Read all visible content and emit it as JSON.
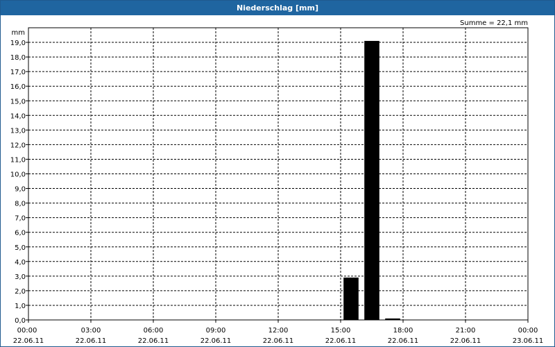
{
  "window": {
    "title": "Niederschlag [mm]"
  },
  "chart_data": {
    "type": "bar",
    "ylabel": "mm",
    "annotation": "Summe = 22,1 mm",
    "ylim": [
      0,
      20
    ],
    "yticks": [
      "0,0",
      "1,0",
      "2,0",
      "3,0",
      "4,0",
      "5,0",
      "6,0",
      "7,0",
      "8,0",
      "9,0",
      "10,0",
      "11,0",
      "12,0",
      "13,0",
      "14,0",
      "15,0",
      "16,0",
      "17,0",
      "18,0",
      "19,0"
    ],
    "xlim_hours": [
      0,
      24
    ],
    "xticks": [
      {
        "time": "00:00",
        "date": "22.06.11"
      },
      {
        "time": "03:00",
        "date": "22.06.11"
      },
      {
        "time": "06:00",
        "date": "22.06.11"
      },
      {
        "time": "09:00",
        "date": "22.06.11"
      },
      {
        "time": "12:00",
        "date": "22.06.11"
      },
      {
        "time": "15:00",
        "date": "22.06.11"
      },
      {
        "time": "18:00",
        "date": "22.06.11"
      },
      {
        "time": "21:00",
        "date": "22.06.11"
      },
      {
        "time": "00:00",
        "date": "23.06.11"
      }
    ],
    "bars": [
      {
        "start": "15:00",
        "end": "16:00",
        "value": 2.9
      },
      {
        "start": "16:00",
        "end": "17:00",
        "value": 19.1
      },
      {
        "start": "17:00",
        "end": "18:00",
        "value": 0.1
      }
    ],
    "bar_color": "#000000",
    "grid": true
  }
}
